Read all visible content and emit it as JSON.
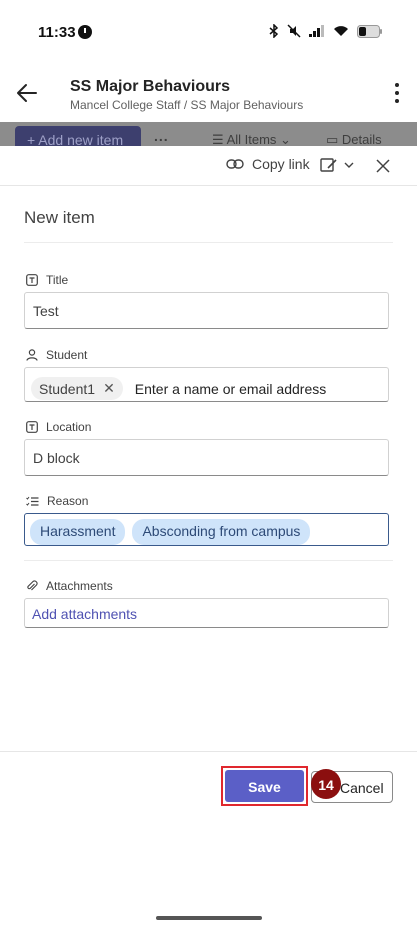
{
  "status_bar": {
    "time": "11:33"
  },
  "header": {
    "title": "SS Major Behaviours",
    "breadcrumb": "Mancel College Staff / SS Major Behaviours",
    "back_icon": "arrow-left-icon",
    "more_icon": "more-vertical-icon"
  },
  "toolbar": {
    "add_new_item": "+ Add new item",
    "more": "...",
    "view": "All Items",
    "details": "Details"
  },
  "panel": {
    "copy_link": "Copy link",
    "heading": "New item"
  },
  "fields": {
    "title": {
      "label": "Title",
      "value": "Test"
    },
    "student": {
      "label": "Student",
      "person": "Student1",
      "placeholder": "Enter a name or email address"
    },
    "location": {
      "label": "Location",
      "value": "D block"
    },
    "reason": {
      "label": "Reason",
      "choices": [
        "Harassment",
        "Absconding from campus"
      ]
    },
    "attachments": {
      "label": "Attachments",
      "action": "Add attachments"
    }
  },
  "footer": {
    "save": "Save",
    "cancel": "Cancel",
    "step_number": "14"
  },
  "colors": {
    "accent": "#5b5fc7",
    "highlight": "#e0282e",
    "badge": "#8b0f0f",
    "chip": "#cfe4fa"
  }
}
